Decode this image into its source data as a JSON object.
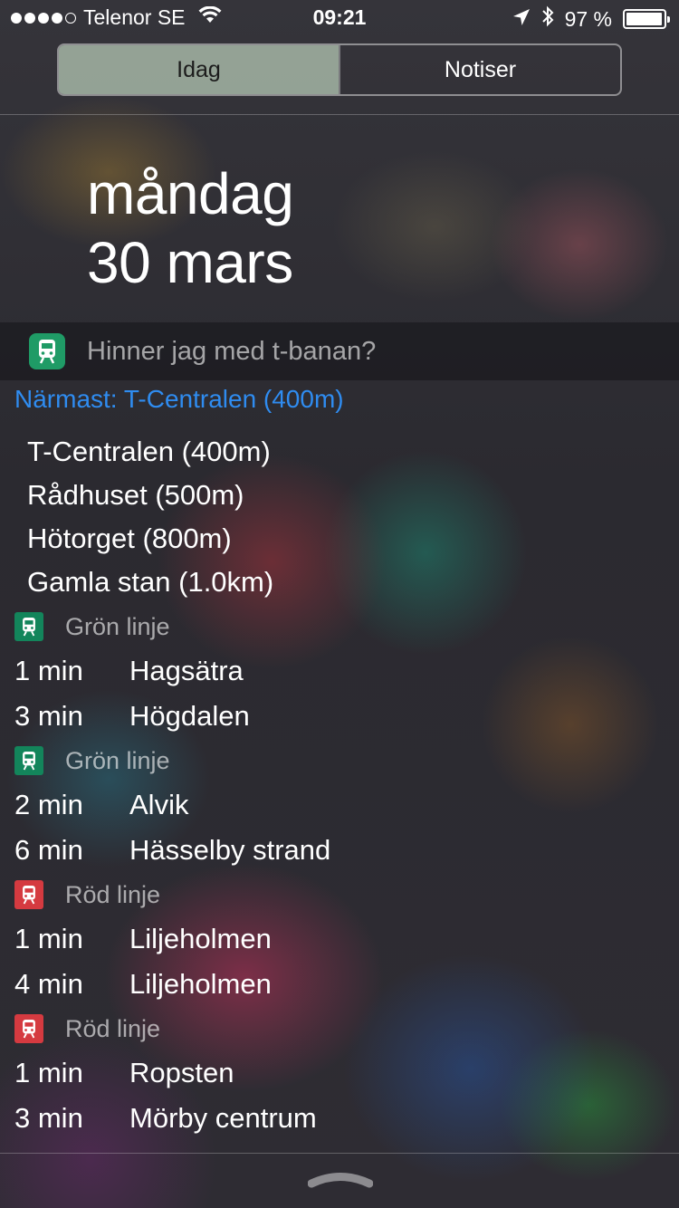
{
  "status_bar": {
    "carrier": "Telenor SE",
    "time": "09:21",
    "battery": "97 %",
    "battery_level": 0.97
  },
  "tabs": [
    {
      "label": "Idag",
      "active": true
    },
    {
      "label": "Notiser",
      "active": false
    }
  ],
  "date": {
    "weekday": "måndag",
    "day_month": "30 mars"
  },
  "widget": {
    "title": "Hinner jag med t-banan?",
    "nearest": "Närmast: T-Centralen (400m)",
    "stations": [
      "T-Centralen (400m)",
      "Rådhuset (500m)",
      "Hötorget (800m)",
      "Gamla stan (1.0km)"
    ],
    "lines": [
      {
        "name": "Grön linje",
        "color": "#13855b",
        "departures": [
          {
            "time": "1 min",
            "destination": "Hagsätra"
          },
          {
            "time": "3 min",
            "destination": "Högdalen"
          }
        ]
      },
      {
        "name": "Grön linje",
        "color": "#13855b",
        "departures": [
          {
            "time": "2 min",
            "destination": "Alvik"
          },
          {
            "time": "6 min",
            "destination": "Hässelby strand"
          }
        ]
      },
      {
        "name": "Röd linje",
        "color": "#d53a40",
        "departures": [
          {
            "time": "1 min",
            "destination": "Liljeholmen"
          },
          {
            "time": "4 min",
            "destination": "Liljeholmen"
          }
        ]
      },
      {
        "name": "Röd linje",
        "color": "#d53a40",
        "departures": [
          {
            "time": "1 min",
            "destination": "Ropsten"
          },
          {
            "time": "3 min",
            "destination": "Mörby centrum"
          }
        ]
      }
    ]
  },
  "colors": {
    "link_blue": "#2f8cf0",
    "app_green": "#1f9b66"
  }
}
